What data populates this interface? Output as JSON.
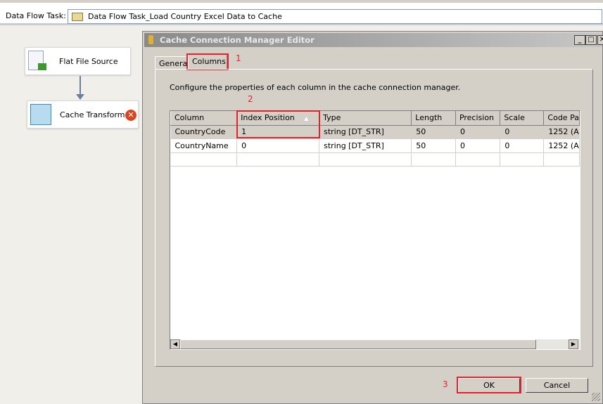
{
  "header": {
    "label": "Data Flow Task:",
    "task_value": "Data Flow Task_Load Country Excel Data to Cache"
  },
  "canvas": {
    "nodes": [
      {
        "label": "Flat File Source"
      },
      {
        "label": "Cache Transform"
      }
    ]
  },
  "dialog": {
    "title": "Cache Connection Manager Editor",
    "tabs": [
      {
        "label": "General"
      },
      {
        "label": "Columns",
        "active": true
      }
    ],
    "description": "Configure the properties of each column in the cache connection manager.",
    "grid": {
      "columns": [
        "Column",
        "Index Position",
        "Type",
        "Length",
        "Precision",
        "Scale",
        "Code Pa"
      ],
      "rows": [
        [
          "CountryCode",
          "1",
          "string [DT_STR]",
          "50",
          "0",
          "0",
          "1252  (A"
        ],
        [
          "CountryName",
          "0",
          "string [DT_STR]",
          "50",
          "0",
          "0",
          "1252  (A"
        ]
      ],
      "sort_indicator": "▲"
    },
    "ok_label": "OK",
    "cancel_label": "Cancel"
  },
  "annotations": [
    "1",
    "2",
    "3"
  ],
  "colors": {
    "highlight": "#e8202a",
    "dialog_bg": "#d4d0c8"
  }
}
